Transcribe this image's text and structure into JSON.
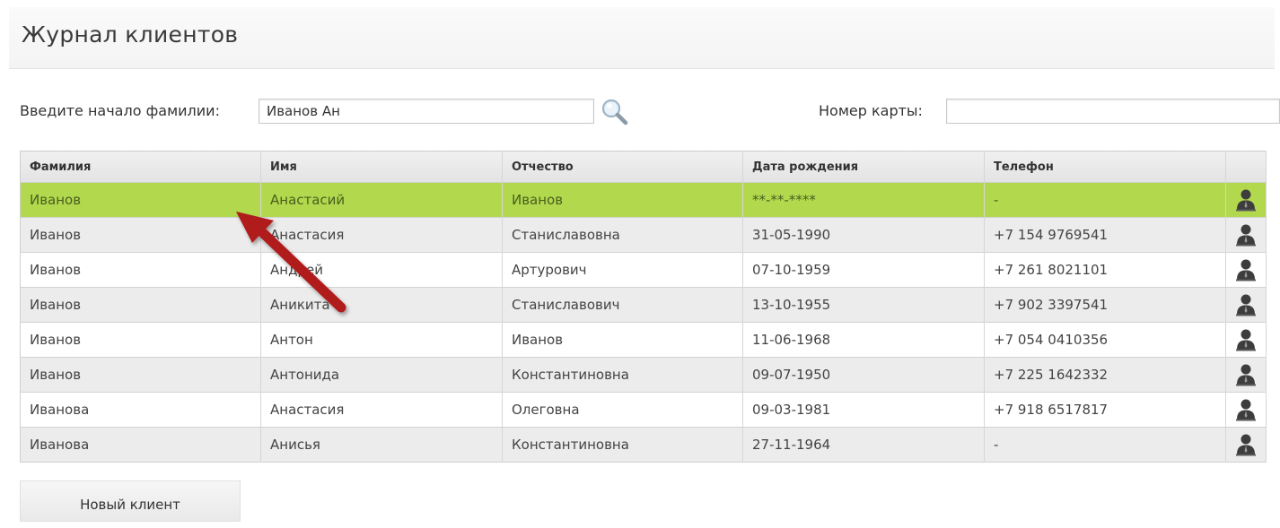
{
  "page": {
    "title": "Журнал клиентов"
  },
  "search": {
    "surname_label": "Введите начало фамилии:",
    "surname_value": "Иванов Ан",
    "card_label": "Номер карты:",
    "card_value": ""
  },
  "table": {
    "headers": {
      "surname": "Фамилия",
      "name": "Имя",
      "patronymic": "Отчество",
      "birth": "Дата рождения",
      "phone": "Телефон"
    },
    "rows": [
      {
        "surname": "Иванов",
        "name": "Анастасий",
        "patronymic": "Иванов",
        "birth": "**-**-****",
        "phone": "-"
      },
      {
        "surname": "Иванов",
        "name": "Анастасия",
        "patronymic": "Станиславовна",
        "birth": "31-05-1990",
        "phone": "+7 154 9769541"
      },
      {
        "surname": "Иванов",
        "name": "Андрей",
        "patronymic": "Артурович",
        "birth": "07-10-1959",
        "phone": "+7 261 8021101"
      },
      {
        "surname": "Иванов",
        "name": "Аникита",
        "patronymic": "Станиславович",
        "birth": "13-10-1955",
        "phone": "+7 902 3397541"
      },
      {
        "surname": "Иванов",
        "name": "Антон",
        "patronymic": "Иванов",
        "birth": "11-06-1968",
        "phone": "+7 054 0410356"
      },
      {
        "surname": "Иванов",
        "name": "Антонида",
        "patronymic": "Константиновна",
        "birth": "09-07-1950",
        "phone": "+7 225 1642332"
      },
      {
        "surname": "Иванова",
        "name": "Анастасия",
        "patronymic": "Олеговна",
        "birth": "09-03-1981",
        "phone": "+7 918 6517817"
      },
      {
        "surname": "Иванова",
        "name": "Анисья",
        "patronymic": "Константиновна",
        "birth": "27-11-1964",
        "phone": "-"
      }
    ],
    "selected_row": 0,
    "row_action_icon": "person-icon"
  },
  "buttons": {
    "new_client": "Новый клиент"
  },
  "colors": {
    "selected_row": "#b2d94e",
    "annotation_arrow": "#b01c1c"
  }
}
